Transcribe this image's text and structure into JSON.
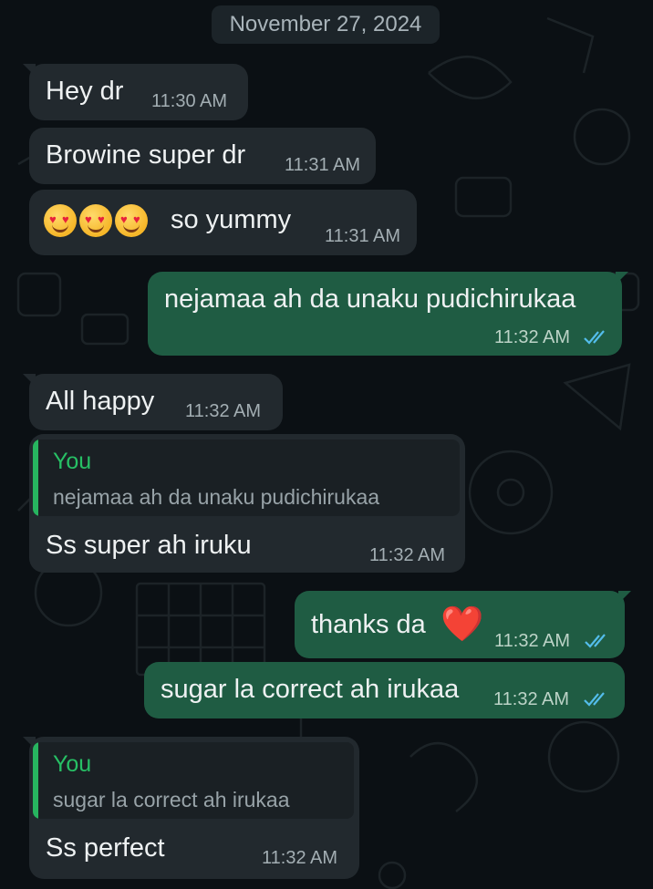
{
  "date_chip": "November 27, 2024",
  "messages": [
    {
      "dir": "in",
      "text": "Hey dr",
      "time": "11:30 AM"
    },
    {
      "dir": "in",
      "text": "Browine super dr",
      "time": "11:31 AM"
    },
    {
      "dir": "in",
      "text": "so yummy",
      "emoji_prefix": "😍😍😍",
      "time": "11:31 AM"
    },
    {
      "dir": "out",
      "text": "nejamaa ah da unaku pudichirukaa",
      "time": "11:32 AM",
      "status": "read"
    },
    {
      "dir": "in",
      "text": "All happy",
      "time": "11:32 AM"
    },
    {
      "dir": "in",
      "reply_to": {
        "author": "You",
        "text": "nejamaa ah da unaku pudichirukaa"
      },
      "text": "Ss super ah iruku",
      "time": "11:32 AM"
    },
    {
      "dir": "out",
      "text": "thanks da",
      "emoji_suffix": "❤️",
      "time": "11:32 AM",
      "status": "read"
    },
    {
      "dir": "out",
      "text": "sugar la correct ah irukaa",
      "time": "11:32 AM",
      "status": "read"
    },
    {
      "dir": "in",
      "reply_to": {
        "author": "You",
        "text": "sugar la correct ah irukaa"
      },
      "text": "Ss perfect",
      "time": "11:32 AM"
    }
  ],
  "colors": {
    "background": "#0b1014",
    "incoming_bubble": "#22292e",
    "outgoing_bubble": "#1f5c43",
    "reply_bar": "#27b45f",
    "read_ticks": "#53bdeb"
  }
}
